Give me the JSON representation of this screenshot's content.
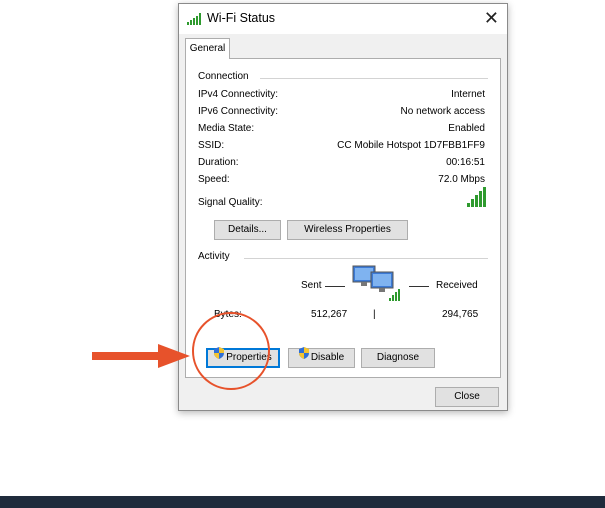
{
  "window": {
    "title": "Wi-Fi Status",
    "close_glyph": "✕"
  },
  "tabs": [
    {
      "label": "General"
    }
  ],
  "connection": {
    "heading": "Connection",
    "rows": [
      {
        "label": "IPv4 Connectivity:",
        "value": "Internet"
      },
      {
        "label": "IPv6 Connectivity:",
        "value": "No network access"
      },
      {
        "label": "Media State:",
        "value": "Enabled"
      },
      {
        "label": "SSID:",
        "value": "CC Mobile Hotspot 1D7FBB1FF9"
      },
      {
        "label": "Duration:",
        "value": "00:16:51"
      },
      {
        "label": "Speed:",
        "value": "72.0 Mbps"
      }
    ],
    "signal_label": "Signal Quality:",
    "signal_bars": 5,
    "details_button": "Details...",
    "wireless_button": "Wireless Properties"
  },
  "activity": {
    "heading": "Activity",
    "sent_label": "Sent",
    "received_label": "Received",
    "bytes_label": "Bytes:",
    "bytes_sent": "512,267",
    "bytes_received": "294,765",
    "separator": "|"
  },
  "actions": {
    "properties": "Properties",
    "disable": "Disable",
    "diagnose": "Diagnose"
  },
  "footer": {
    "close": "Close"
  },
  "icons": {
    "title": "wifi-signal-icon",
    "signal": "signal-bars-icon",
    "network": "network-computers-icon",
    "shield": "uac-shield-icon",
    "arrow": "pointer-arrow",
    "highlight": "highlight-circle"
  },
  "colors": {
    "accent": "#e7522b",
    "signal_green": "#2e9a2e",
    "focus_blue": "#0078d7",
    "footer_band": "#1f2b3c"
  }
}
